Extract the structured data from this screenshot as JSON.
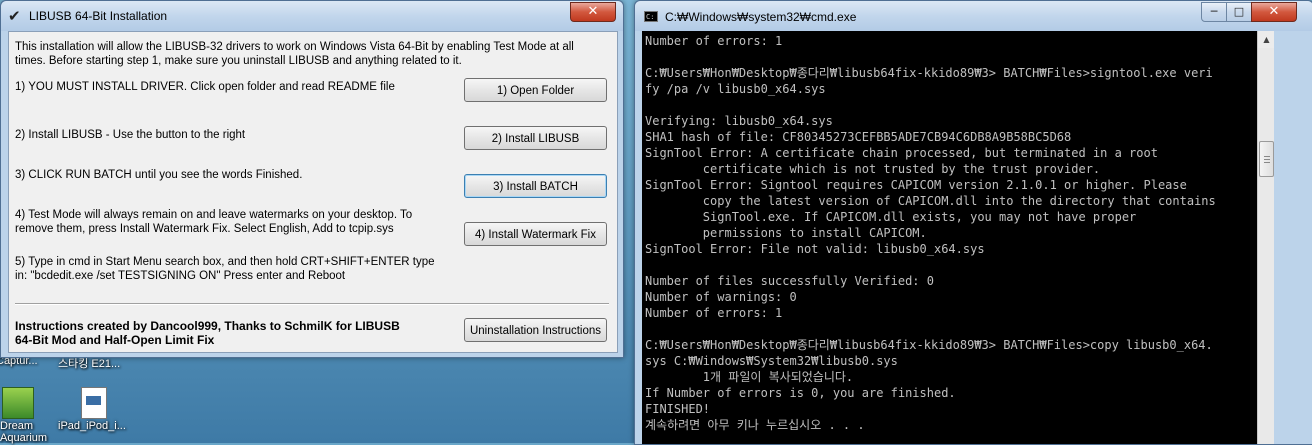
{
  "installer": {
    "title": "LIBUSB 64-Bit Installation",
    "close_label": "✕",
    "intro": "This installation will allow the LIBUSB-32 drivers to work on Windows Vista 64-Bit by enabling Test Mode at all times. Before starting step 1, make sure you uninstall LIBUSB and anything related to it.",
    "steps": [
      {
        "text": "1) YOU MUST INSTALL DRIVER. Click open folder and read README file",
        "button": "1) Open Folder"
      },
      {
        "text": "2) Install LIBUSB - Use the button to the right",
        "button": "2) Install LIBUSB"
      },
      {
        "text": "3) CLICK RUN BATCH until you see the words Finished.",
        "button": "3) Install BATCH"
      },
      {
        "text": "4) Test Mode will always remain on and leave watermarks on your desktop. To remove them, press Install Watermark Fix. Select English, Add to tcpip.sys",
        "button": "4) Install Watermark Fix"
      },
      {
        "text": "5) Type in cmd in Start Menu search box, and then hold CRT+SHIFT+ENTER type in: \"bcdedit.exe /set TESTSIGNING ON\" Press enter and Reboot"
      }
    ],
    "credits": "Instructions created by Dancool999, Thanks to SchmilK for LIBUSB 64-Bit Mod and Half-Open Limit Fix",
    "uninstall_button": "Uninstallation Instructions"
  },
  "desktop": {
    "icons": [
      {
        "label": "Captur...",
        "icon": "image-icon"
      },
      {
        "label": "스타킹 E21...",
        "icon": "video-icon"
      },
      {
        "label": "Dream Aquarium",
        "icon": "app-icon"
      },
      {
        "label": "iPad_iPod_i...",
        "icon": "document-icon"
      }
    ]
  },
  "cmd": {
    "title": "C:₩Windows₩system32₩cmd.exe",
    "minimize_label": "─",
    "maximize_label": "□",
    "close_label": "✕",
    "lines": [
      "Number of errors: 1",
      "",
      "C:₩Users₩Hon₩Desktop₩종다리₩libusb64fix-kkido89₩3> BATCH₩Files>signtool.exe veri",
      "fy /pa /v libusb0_x64.sys",
      "",
      "Verifying: libusb0_x64.sys",
      "SHA1 hash of file: CF80345273CEFBB5ADE7CB94C6DB8A9B58BC5D68",
      "SignTool Error: A certificate chain processed, but terminated in a root",
      "        certificate which is not trusted by the trust provider.",
      "SignTool Error: Signtool requires CAPICOM version 2.1.0.1 or higher. Please",
      "        copy the latest version of CAPICOM.dll into the directory that contains",
      "        SignTool.exe. If CAPICOM.dll exists, you may not have proper",
      "        permissions to install CAPICOM.",
      "SignTool Error: File not valid: libusb0_x64.sys",
      "",
      "Number of files successfully Verified: 0",
      "Number of warnings: 0",
      "Number of errors: 1",
      "",
      "C:₩Users₩Hon₩Desktop₩종다리₩libusb64fix-kkido89₩3> BATCH₩Files>copy libusb0_x64.",
      "sys C:₩Windows₩System32₩libusb0.sys",
      "        1개 파일이 복사되었습니다.",
      "If Number of errors is 0, you are finished.",
      "FINISHED!",
      "계속하려면 아무 키나 누르십시오 . . ."
    ]
  }
}
